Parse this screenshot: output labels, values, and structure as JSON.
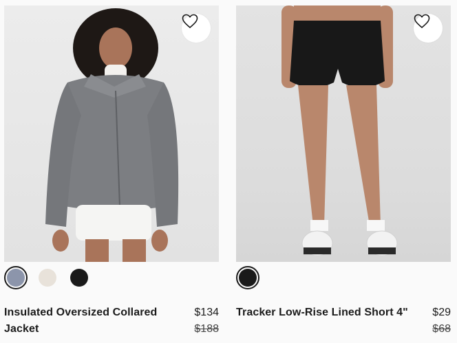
{
  "products": [
    {
      "name": "Insulated Oversized Collared Jacket",
      "price": "$134",
      "original_price": "$188",
      "swatches": [
        "#8c95ab",
        "#e8e2da",
        "#1a1a1a"
      ],
      "selected_swatch": 0,
      "wishlist_icon": "heart-outline-icon"
    },
    {
      "name": "Tracker Low-Rise Lined Short 4\"",
      "price": "$29",
      "original_price": "$68",
      "swatches": [
        "#1a1a1a"
      ],
      "selected_swatch": 0,
      "wishlist_icon": "heart-outline-icon"
    }
  ]
}
